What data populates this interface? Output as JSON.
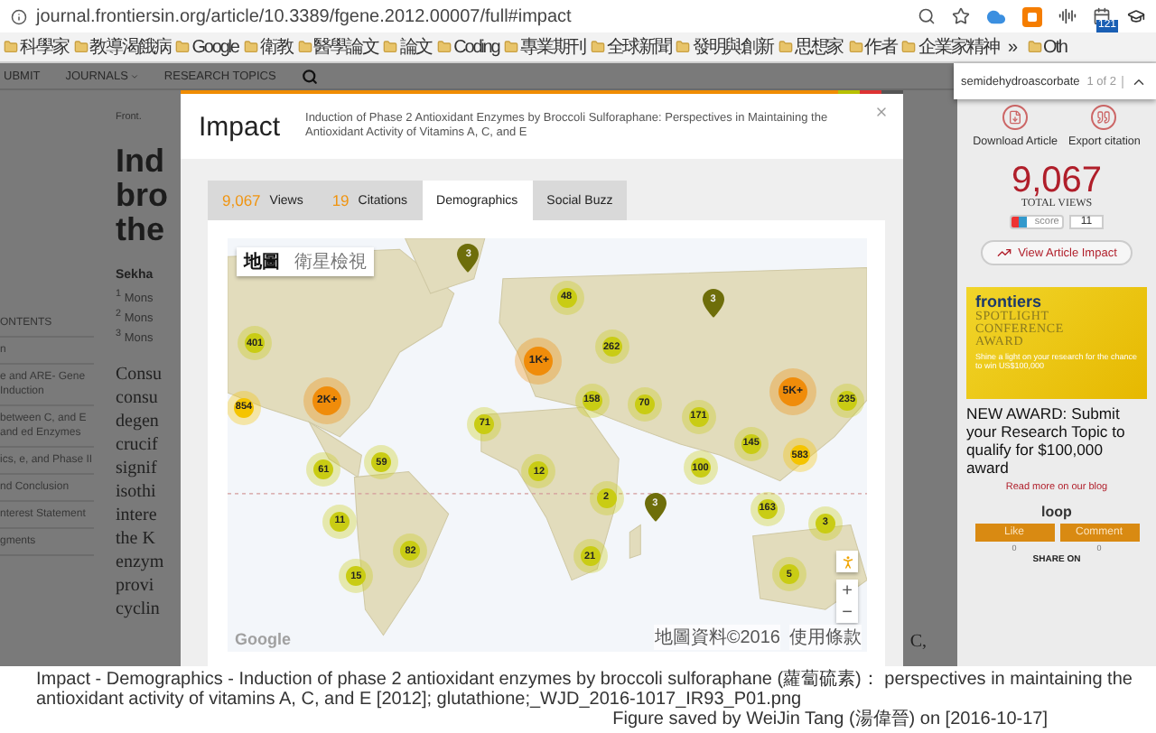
{
  "browser": {
    "url": "journal.frontiersin.org/article/10.3389/fgene.2012.00007/full#impact",
    "extension_badge": "121"
  },
  "bookmarks": [
    {
      "label": "科學家"
    },
    {
      "label": "教導渴餓病"
    },
    {
      "label": "Google"
    },
    {
      "label": "衛教"
    },
    {
      "label": "醫學論文"
    },
    {
      "label": "論文"
    },
    {
      "label": "Coding"
    },
    {
      "label": "專業期刊"
    },
    {
      "label": "全球新聞"
    },
    {
      "label": "發明與創新"
    },
    {
      "label": "思想家"
    },
    {
      "label": "作者"
    },
    {
      "label": "企業家精神"
    }
  ],
  "bookmarks_more": "»",
  "bookmarks_other": "Oth",
  "site_nav": [
    "UBMIT",
    "JOURNALS",
    "RESEARCH TOPICS"
  ],
  "find_bar": {
    "query": "semidehydroascorbate",
    "count": "1 of 2"
  },
  "toc": {
    "heading": "ONTENTS",
    "items": [
      "n",
      "e and ARE- Gene Induction",
      "between C, and E and ed Enzymes",
      "ics, e, and Phase II",
      "nd Conclusion",
      "nterest Statement",
      "gments"
    ]
  },
  "article": {
    "journal": "Front.",
    "title_lines": [
      "Ind",
      "bro",
      "the"
    ],
    "author": "Sekha",
    "affiliations": [
      "$^{1}$ Mons",
      "$^{2}$ Mons",
      "$^{3}$ Mons"
    ],
    "body_lines": [
      "Consu",
      "consu",
      "degen",
      "crucif",
      "signif",
      "isothi",
      "intere",
      "the K",
      "enzym",
      "provi",
      "cyclin"
    ]
  },
  "bg_fragment": "C,",
  "modal": {
    "title": "Impact",
    "subtitle": "Induction of Phase 2 Antioxidant Enzymes by Broccoli Sulforaphane: Perspectives in Maintaining the Antioxidant Activity of Vitamins A, C, and E",
    "tabs": [
      {
        "count": "9,067",
        "label": "Views",
        "selected": false
      },
      {
        "count": "19",
        "label": "Citations",
        "selected": false
      },
      {
        "label": "Demographics",
        "selected": true
      },
      {
        "label": "Social Buzz",
        "selected": false
      }
    ],
    "map": {
      "map_types": [
        {
          "label": "地圖",
          "selected": true
        },
        {
          "label": "衛星檢視",
          "selected": false
        }
      ],
      "markers": [
        {
          "kind": "pin",
          "label": "3",
          "color": "#6e6e0a"
        },
        {
          "kind": "cluster",
          "label": "48",
          "color": "#c9cc14"
        },
        {
          "kind": "pin",
          "label": "3",
          "color": "#6e6e0a"
        },
        {
          "kind": "cluster",
          "label": "401",
          "color": "#c9cc14"
        },
        {
          "kind": "cluster",
          "label": "262",
          "color": "#c9cc14"
        },
        {
          "kind": "large",
          "label": "1K+",
          "color": "#f08c0a"
        },
        {
          "kind": "cluster",
          "label": "854",
          "color": "#f5c400"
        },
        {
          "kind": "large",
          "label": "2K+",
          "color": "#f08c0a"
        },
        {
          "kind": "cluster",
          "label": "158",
          "color": "#c9cc14"
        },
        {
          "kind": "cluster",
          "label": "70",
          "color": "#c9cc14"
        },
        {
          "kind": "large",
          "label": "5K+",
          "color": "#f08c0a"
        },
        {
          "kind": "cluster",
          "label": "235",
          "color": "#c9cc14"
        },
        {
          "kind": "cluster",
          "label": "171",
          "color": "#c9cc14"
        },
        {
          "kind": "cluster",
          "label": "71",
          "color": "#c9cc14"
        },
        {
          "kind": "cluster",
          "label": "145",
          "color": "#c9cc14"
        },
        {
          "kind": "cluster",
          "label": "61",
          "color": "#c9cc14"
        },
        {
          "kind": "cluster",
          "label": "59",
          "color": "#c9cc14"
        },
        {
          "kind": "cluster",
          "label": "12",
          "color": "#c9cc14"
        },
        {
          "kind": "cluster",
          "label": "100",
          "color": "#c9cc14"
        },
        {
          "kind": "cluster",
          "label": "583",
          "color": "#f5c400"
        },
        {
          "kind": "cluster",
          "label": "2",
          "color": "#c9cc14"
        },
        {
          "kind": "cluster",
          "label": "163",
          "color": "#c9cc14"
        },
        {
          "kind": "cluster",
          "label": "11",
          "color": "#c9cc14"
        },
        {
          "kind": "pin",
          "label": "3",
          "color": "#6e6e0a"
        },
        {
          "kind": "cluster",
          "label": "3",
          "color": "#c9cc14"
        },
        {
          "kind": "cluster",
          "label": "82",
          "color": "#c9cc14"
        },
        {
          "kind": "cluster",
          "label": "21",
          "color": "#c9cc14"
        },
        {
          "kind": "cluster",
          "label": "15",
          "color": "#c9cc14"
        },
        {
          "kind": "cluster",
          "label": "5",
          "color": "#c9cc14"
        }
      ],
      "zoom_in": "+",
      "zoom_out": "−",
      "logo": "Google",
      "attribution": "地圖資料©2016",
      "terms": "使用條款"
    }
  },
  "sidebar": {
    "actions": [
      {
        "kind": "download",
        "label": "Download Article"
      },
      {
        "kind": "citation",
        "label": "Export citation"
      }
    ],
    "views": "9,067",
    "views_label": "TOTAL VIEWS",
    "altmetric": {
      "label": "score",
      "value": "11"
    },
    "impact_button": "View Article Impact",
    "ad": {
      "brand": "frontiers",
      "title_lines": [
        "SPOTLIGHT",
        "CONFERENCE",
        "AWARD"
      ],
      "tagline": "Shine a light on your research for the chance to win US$100,000"
    },
    "headline": "NEW AWARD: Submit your Research Topic to qualify for $100,000 award",
    "blog_link": "Read more on our blog",
    "loop": {
      "logo": "loop",
      "buttons": [
        {
          "label": "Like",
          "count": "0"
        },
        {
          "label": "Comment",
          "count": "0"
        }
      ]
    },
    "share": "SHARE ON"
  },
  "caption": {
    "text": "Impact - Demographics - Induction of phase 2 antioxidant enzymes by broccoli sulforaphane (蘿蔔硫素)： perspectives in maintaining the antioxidant activity of vitamins A, C, and E [2012]; glutathione;_WJD_2016-1017_IR93_P01.png",
    "credit": "Figure saved by WeiJin Tang (湯偉晉) on [2016-10-17]"
  }
}
